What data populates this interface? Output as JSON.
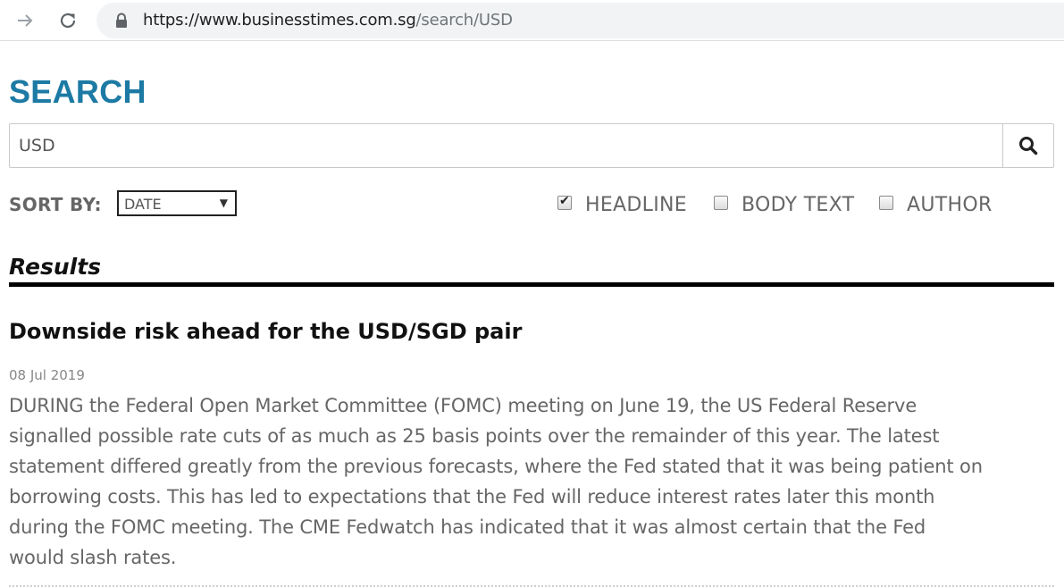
{
  "browser": {
    "url_base": "https://www.businesstimes.com.sg",
    "url_path": "/search/USD"
  },
  "page": {
    "title": "SEARCH"
  },
  "search": {
    "value": "USD"
  },
  "sort": {
    "label": "SORT BY:",
    "selected": "DATE"
  },
  "filters": {
    "headline": {
      "label": "HEADLINE",
      "checked": true
    },
    "body_text": {
      "label": "BODY TEXT",
      "checked": false
    },
    "author": {
      "label": "AUTHOR",
      "checked": false
    }
  },
  "results": {
    "heading": "Results",
    "items": [
      {
        "title": "Downside risk ahead for the USD/SGD pair",
        "date": "08 Jul 2019",
        "lines": [
          "DURING the Federal Open Market Committee (FOMC) meeting on June 19, the US Federal Reserve",
          "signalled possible rate cuts of as much as 25 basis points over the remainder of this year. The latest",
          "statement differed greatly from the previous forecasts, where the Fed stated that it was being patient on",
          "borrowing costs. This has led to expectations that the Fed will reduce interest rates later this month",
          "during the FOMC meeting. The CME Fedwatch has indicated that it was almost certain that the Fed",
          "would slash rates."
        ]
      }
    ]
  },
  "colors": {
    "title_blue": "#1c7aa4",
    "body_gray": "#666666"
  },
  "icons": [
    "forward-arrow-icon",
    "reload-icon",
    "lock-icon",
    "search-icon",
    "chevron-down-icon",
    "checkmark-icon"
  ]
}
